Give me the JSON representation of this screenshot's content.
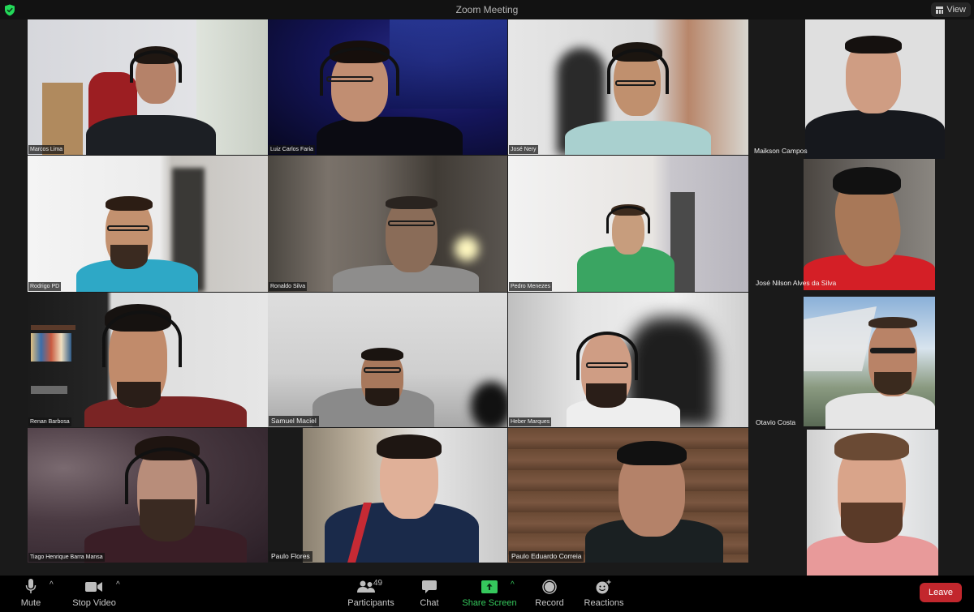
{
  "window": {
    "title": "Zoom Meeting",
    "security_icon": "shield-check-icon",
    "security_color": "#23d959",
    "view_label": "View",
    "view_icon": "grid-view-icon"
  },
  "participants_grid": [
    {
      "name": "Marcos Lima",
      "row": 1,
      "col": 1
    },
    {
      "name": "Luiz Carlos Faria",
      "row": 1,
      "col": 2
    },
    {
      "name": "José Nery",
      "row": 1,
      "col": 3
    },
    {
      "name": "Maikson Campos",
      "row": 1,
      "col": 4
    },
    {
      "name": "Rodrigo PD",
      "row": 2,
      "col": 1
    },
    {
      "name": "Ronaldo Silva",
      "row": 2,
      "col": 2
    },
    {
      "name": "Pedro Menezes",
      "row": 2,
      "col": 3
    },
    {
      "name": "José Nilson Alves da Silva",
      "row": 2,
      "col": 4
    },
    {
      "name": "Renan Barbosa",
      "row": 3,
      "col": 1
    },
    {
      "name": "Samuel Maciel",
      "row": 3,
      "col": 2
    },
    {
      "name": "Heber Marques",
      "row": 3,
      "col": 3
    },
    {
      "name": "Otavio Costa",
      "row": 3,
      "col": 4
    },
    {
      "name": "Tiago Henrique Barra Mansa",
      "row": 4,
      "col": 1
    },
    {
      "name": "Paulo Flores",
      "row": 4,
      "col": 2
    },
    {
      "name": "Paulo Eduardo Correia",
      "row": 4,
      "col": 3
    },
    {
      "name": "",
      "row": 4,
      "col": 4
    }
  ],
  "toolbar": {
    "mute_label": "Mute",
    "mute_icon": "microphone-icon",
    "stop_video_label": "Stop Video",
    "stop_video_icon": "video-camera-icon",
    "participants_label": "Participants",
    "participants_count": "49",
    "participants_icon": "people-icon",
    "chat_label": "Chat",
    "chat_icon": "chat-bubble-icon",
    "share_screen_label": "Share Screen",
    "share_screen_icon": "share-up-arrow-icon",
    "share_color": "#35c85c",
    "record_label": "Record",
    "record_icon": "record-circle-icon",
    "reactions_label": "Reactions",
    "reactions_icon": "smiley-plus-icon",
    "leave_label": "Leave",
    "leave_color": "#c2272d",
    "caret": "^"
  }
}
